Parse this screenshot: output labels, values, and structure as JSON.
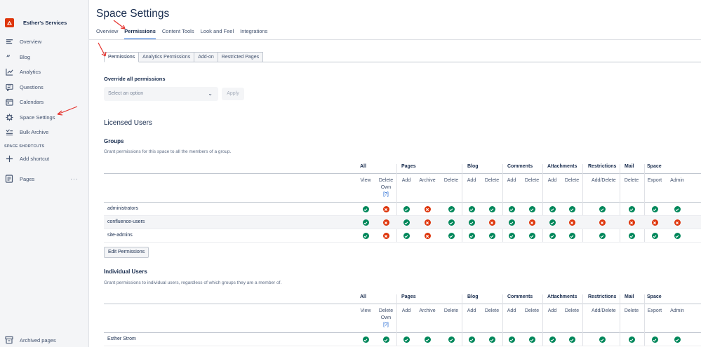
{
  "sidebar": {
    "space_name": "Esther's Services",
    "items": [
      {
        "label": "Overview",
        "icon": "overview-icon"
      },
      {
        "label": "Blog",
        "icon": "quote-icon"
      },
      {
        "label": "Analytics",
        "icon": "analytics-icon"
      },
      {
        "label": "Questions",
        "icon": "questions-icon"
      },
      {
        "label": "Calendars",
        "icon": "calendar-icon"
      },
      {
        "label": "Space Settings",
        "icon": "gear-icon"
      },
      {
        "label": "Bulk Archive",
        "icon": "bulk-archive-icon"
      }
    ],
    "shortcuts_title": "SPACE SHORTCUTS",
    "add_shortcut": "Add shortcut",
    "pages": "Pages",
    "pages_more": "···",
    "archived": "Archived pages"
  },
  "main": {
    "title": "Space Settings",
    "tabs": [
      "Overview",
      "Permissions",
      "Content Tools",
      "Look and Feel",
      "Integrations"
    ],
    "active_tab": "Permissions",
    "sub_tabs": [
      "Permissions",
      "Analytics Permissions",
      "Add-on",
      "Restricted Pages"
    ],
    "override_label": "Override all permissions",
    "select_placeholder": "Select an option",
    "apply": "Apply",
    "licensed_title": "Licensed Users",
    "groups_title": "Groups",
    "groups_desc": "Grant permissions for this space to all the members of a group.",
    "edit_permissions": "Edit Permissions",
    "individual_title": "Individual Users",
    "individual_desc": "Grant permissions to individual users, regardless of which groups they are a member of."
  },
  "table": {
    "groups": [
      "All",
      "Pages",
      "Blog",
      "Comments",
      "Attachments",
      "Restrictions",
      "Mail",
      "Space"
    ],
    "columns": [
      "View",
      "Delete Own",
      "Add",
      "Archive",
      "Delete",
      "Add",
      "Delete",
      "Add",
      "Delete",
      "Add",
      "Delete",
      "Add/Delete",
      "Delete",
      "Export",
      "Admin"
    ],
    "delete_own_line1": "Delete",
    "delete_own_line2": "Own",
    "hint": "[?]",
    "group_rows": [
      {
        "name": "administrators",
        "perms": [
          1,
          0,
          1,
          0,
          1,
          1,
          1,
          1,
          1,
          1,
          1,
          1,
          1,
          1,
          1
        ]
      },
      {
        "name": "confluence-users",
        "perms": [
          1,
          0,
          1,
          0,
          1,
          1,
          0,
          1,
          0,
          1,
          0,
          0,
          0,
          0,
          0
        ]
      },
      {
        "name": "site-admins",
        "perms": [
          1,
          0,
          1,
          0,
          1,
          1,
          1,
          1,
          1,
          1,
          1,
          1,
          1,
          1,
          1
        ]
      }
    ],
    "user_rows": [
      {
        "name": "Esther Strom",
        "perms": [
          1,
          1,
          1,
          1,
          1,
          1,
          1,
          1,
          1,
          1,
          1,
          1,
          1,
          1,
          1
        ]
      }
    ]
  },
  "colors": {
    "yes": "#00875a",
    "no": "#de350b",
    "accent": "#0052cc",
    "annotation": "#e5322d"
  }
}
